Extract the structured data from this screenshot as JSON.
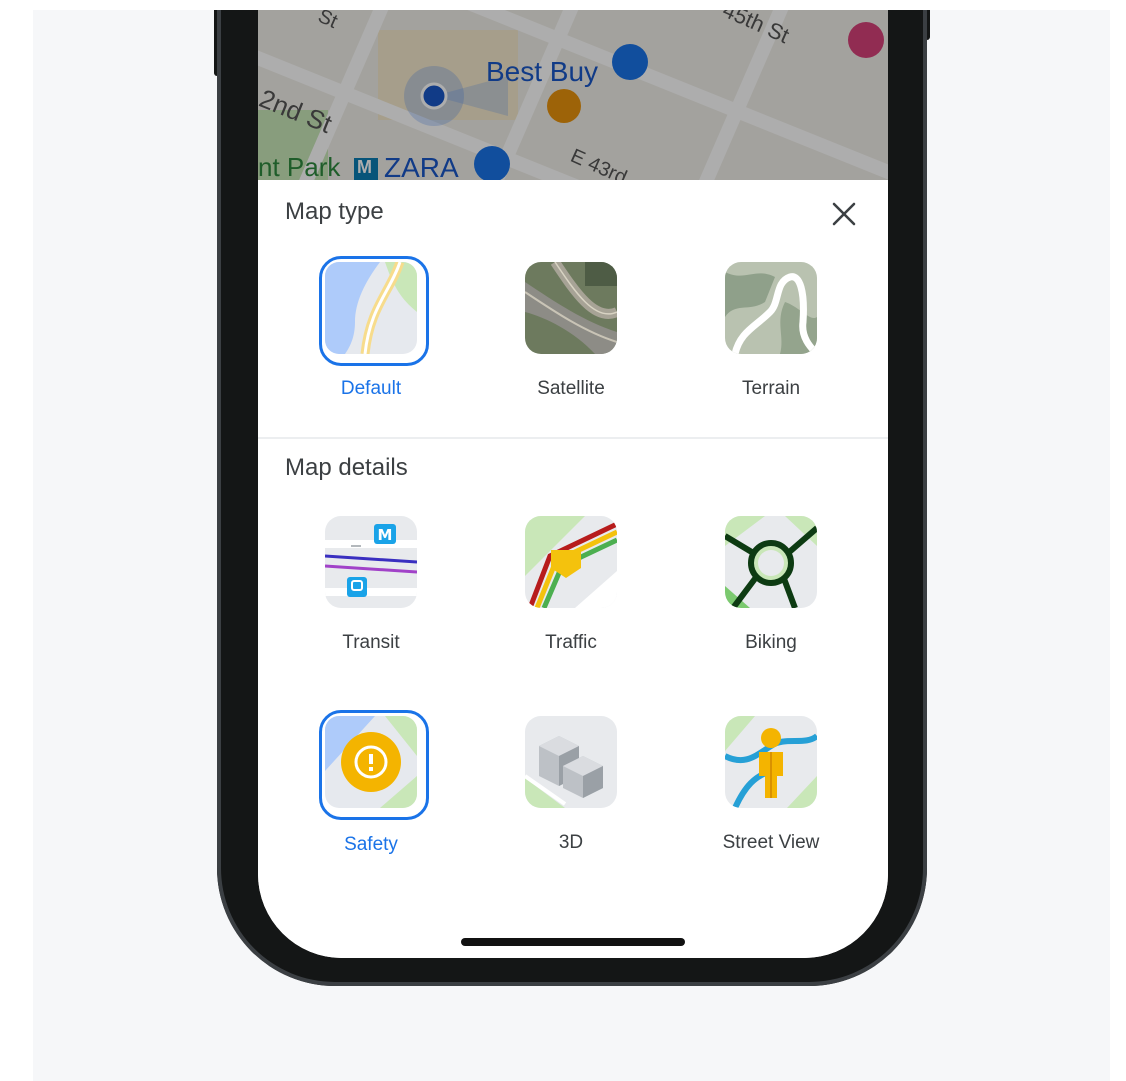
{
  "map_preview": {
    "street_labels": [
      "45th St",
      "2nd St",
      "E 43rd",
      "St"
    ],
    "places": [
      "Best Buy",
      "ZARA",
      "nt Park"
    ],
    "metro_badge": "M"
  },
  "map_type": {
    "title": "Map type",
    "options": [
      {
        "label": "Default",
        "selected": true,
        "icon": "default-map-icon"
      },
      {
        "label": "Satellite",
        "selected": false,
        "icon": "satellite-map-icon"
      },
      {
        "label": "Terrain",
        "selected": false,
        "icon": "terrain-map-icon"
      }
    ]
  },
  "map_details": {
    "title": "Map details",
    "options": [
      {
        "label": "Transit",
        "selected": false,
        "icon": "transit-icon"
      },
      {
        "label": "Traffic",
        "selected": false,
        "icon": "traffic-icon"
      },
      {
        "label": "Biking",
        "selected": false,
        "icon": "biking-icon"
      },
      {
        "label": "Safety",
        "selected": true,
        "icon": "safety-icon"
      },
      {
        "label": "3D",
        "selected": false,
        "icon": "3d-buildings-icon"
      },
      {
        "label": "Street View",
        "selected": false,
        "icon": "street-view-icon"
      }
    ]
  },
  "colors": {
    "accent": "#1a73e8",
    "text": "#3c4043",
    "background": "#f6f7f9"
  }
}
